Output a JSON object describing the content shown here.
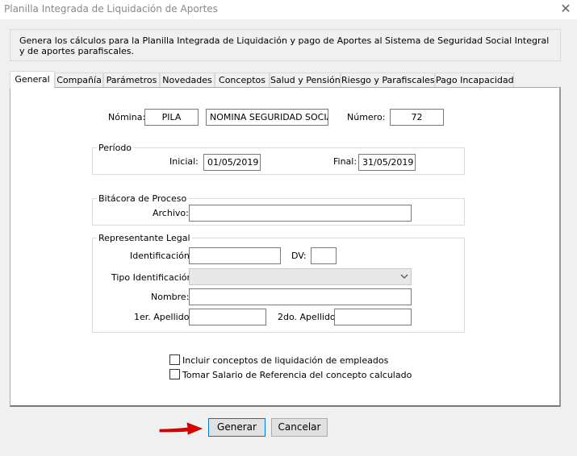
{
  "window": {
    "title": "Planilla Integrada de Liquidación de Aportes",
    "close_glyph": "✕"
  },
  "description": "Genera los cálculos para la Planilla Integrada de Liquidación y pago de Aportes al Sistema de Seguridad Social Integral y de aportes parafiscales.",
  "tabs": [
    {
      "label": "General"
    },
    {
      "label": "Compañía"
    },
    {
      "label": "Parámetros"
    },
    {
      "label": "Novedades"
    },
    {
      "label": "Conceptos"
    },
    {
      "label": "Salud y Pensión"
    },
    {
      "label": "Riesgo y Parafiscales"
    },
    {
      "label": "Pago Incapacidad"
    }
  ],
  "general": {
    "nomina_label": "Nómina:",
    "nomina_code": "PILA",
    "nomina_name": "NOMINA SEGURIDAD SOCIAL",
    "numero_label": "Número:",
    "numero_value": "72",
    "periodo": {
      "legend": "Período",
      "inicial_label": "Inicial:",
      "inicial_value": "01/05/2019",
      "final_label": "Final:",
      "final_value": "31/05/2019"
    },
    "bitacora": {
      "legend": "Bitácora de Proceso",
      "archivo_label": "Archivo:",
      "archivo_value": ""
    },
    "representante": {
      "legend": "Representante Legal",
      "identificacion_label": "Identificación:",
      "identificacion_value": "",
      "dv_label": "DV:",
      "dv_value": "",
      "tipo_label": "Tipo Identificación:",
      "tipo_value": "",
      "nombre_label": "Nombre:",
      "nombre_value": "",
      "apellido1_label": "1er. Apellido:",
      "apellido1_value": "",
      "apellido2_label": "2do. Apellido:",
      "apellido2_value": ""
    },
    "checkboxes": [
      {
        "label": "Incluir conceptos de liquidación de empleados",
        "checked": false
      },
      {
        "label": "Tomar Salario de Referencia del concepto calculado",
        "checked": false
      }
    ]
  },
  "buttons": {
    "generar": "Generar",
    "cancelar": "Cancelar"
  },
  "colors": {
    "arrow": "#e00000",
    "focus": "#0078d7"
  }
}
